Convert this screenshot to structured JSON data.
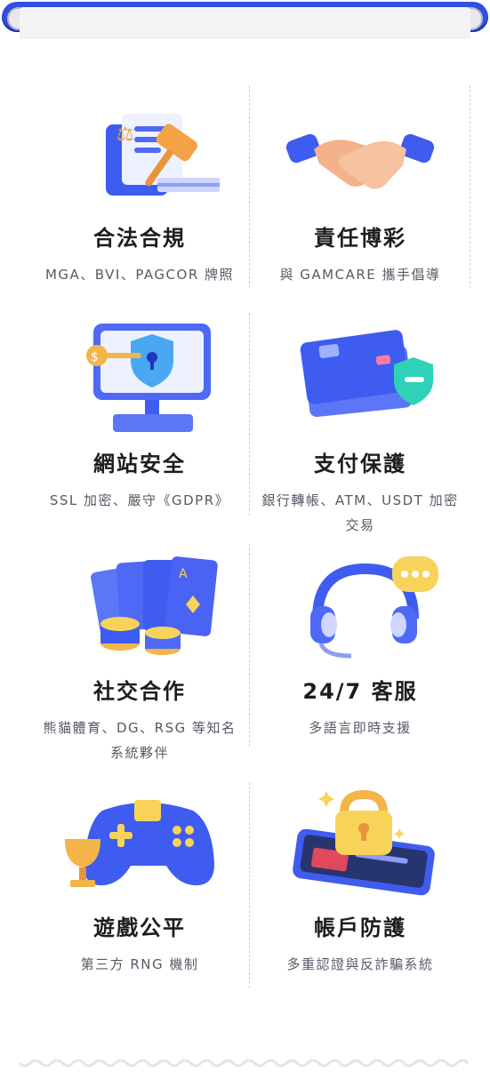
{
  "features": [
    {
      "title": "合法合規",
      "desc": "MGA、BVI、PAGCOR 牌照",
      "icon": "legal-gavel-folder-icon"
    },
    {
      "title": "責任博彩",
      "desc": "與 GAMCARE 攜手倡導",
      "icon": "handshake-icon"
    },
    {
      "title": "網站安全",
      "desc": "SSL 加密、嚴守《GDPR》",
      "icon": "monitor-shield-key-icon"
    },
    {
      "title": "支付保護",
      "desc": "銀行轉帳、ATM、USDT 加密交易",
      "icon": "payment-cards-shield-icon"
    },
    {
      "title": "社交合作",
      "desc": "熊貓體育、DG、RSG 等知名系統夥伴",
      "icon": "playing-cards-chips-icon"
    },
    {
      "title": "24/7 客服",
      "desc": "多語言即時支援",
      "icon": "headset-chat-icon"
    },
    {
      "title": "遊戲公平",
      "desc": "第三方 RNG 機制",
      "icon": "gamepad-trophy-icon"
    },
    {
      "title": "帳戶防護",
      "desc": "多重認證與反詐騙系統",
      "icon": "phone-padlock-icon"
    }
  ],
  "colors": {
    "accent": "#2f4fe0",
    "title": "#1d1d1f",
    "desc": "#555a66"
  }
}
